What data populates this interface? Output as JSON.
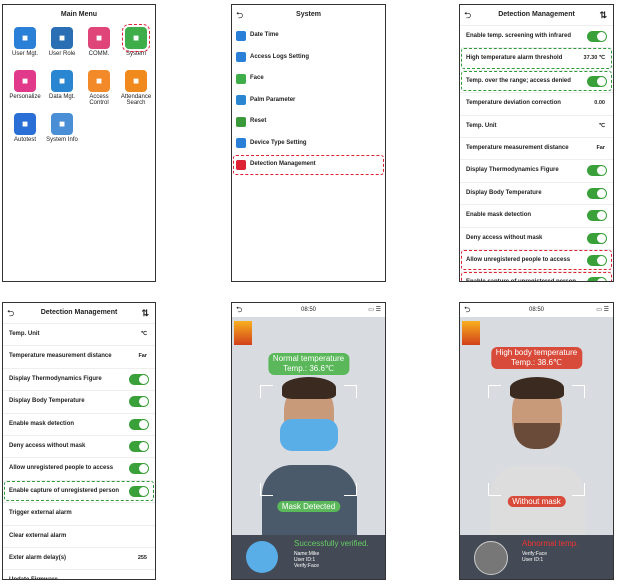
{
  "main_menu": {
    "title": "Main Menu",
    "items": [
      {
        "label": "User Mgt.",
        "color": "#2a7fd6"
      },
      {
        "label": "User Role",
        "color": "#2a6fb3"
      },
      {
        "label": "COMM.",
        "color": "#e0457a"
      },
      {
        "label": "System",
        "color": "#3fae4a"
      },
      {
        "label": "Personalize",
        "color": "#e23a8a"
      },
      {
        "label": "Data Mgt.",
        "color": "#2a86d0"
      },
      {
        "label": "Access Control",
        "color": "#f28a2a"
      },
      {
        "label": "Attendance Search",
        "color": "#f08a1d"
      },
      {
        "label": "Autotest",
        "color": "#2a6fd6"
      },
      {
        "label": "System Info",
        "color": "#4a8fd6"
      }
    ]
  },
  "system": {
    "title": "System",
    "items": [
      {
        "label": "Date Time",
        "color": "#2a7fd6"
      },
      {
        "label": "Access Logs Setting",
        "color": "#2a7fd6"
      },
      {
        "label": "Face",
        "color": "#3fae4a"
      },
      {
        "label": "Palm Parameter",
        "color": "#2a86d0"
      },
      {
        "label": "Reset",
        "color": "#3a9a3a"
      },
      {
        "label": "Device Type Setting",
        "color": "#2a7fd6"
      },
      {
        "label": "Detection Management",
        "color": "#d23"
      }
    ]
  },
  "detection1": {
    "title": "Detection Management",
    "rows": [
      {
        "label": "Enable temp. screening with infrared",
        "toggle": true
      },
      {
        "label": "High temperature alarm threshold",
        "value": "37.30 ℃"
      },
      {
        "label": "Temp. over the range; access denied",
        "toggle": true
      },
      {
        "label": "Temperature deviation correction",
        "value": "0.00"
      },
      {
        "label": "Temp. Unit",
        "value": "℃"
      },
      {
        "label": "Temperature measurement distance",
        "value": "Far"
      },
      {
        "label": "Display Thermodynamics Figure",
        "toggle": true
      },
      {
        "label": "Display Body Temperature",
        "toggle": true
      },
      {
        "label": "Enable mask detection",
        "toggle": true
      },
      {
        "label": "Deny access without mask",
        "toggle": true
      },
      {
        "label": "Allow unregistered people to access",
        "toggle": true
      },
      {
        "label": "Enable capture of unregistered person",
        "toggle": true
      }
    ]
  },
  "detection2": {
    "title": "Detection Management",
    "rows": [
      {
        "label": "Temp. Unit",
        "value": "℃"
      },
      {
        "label": "Temperature measurement distance",
        "value": "Far"
      },
      {
        "label": "Display Thermodynamics Figure",
        "toggle": true
      },
      {
        "label": "Display Body Temperature",
        "toggle": true
      },
      {
        "label": "Enable mask detection",
        "toggle": true
      },
      {
        "label": "Deny access without mask",
        "toggle": true
      },
      {
        "label": "Allow unregistered people to access",
        "toggle": true
      },
      {
        "label": "Enable capture of unregistered person",
        "toggle": true
      },
      {
        "label": "Trigger external alarm"
      },
      {
        "label": "Clear external alarm"
      },
      {
        "label": "Exter alarm delay(s)",
        "value": "255"
      },
      {
        "label": "Update Firmware"
      }
    ]
  },
  "screen_normal": {
    "time": "08:50",
    "temp_title": "Normal temperature",
    "temp_value": "Temp.: 36.6℃",
    "mask_label": "Mask Detected",
    "status": "Successfully verified.",
    "name": "Name:Mike",
    "userid": "User ID:1",
    "verify": "Verify:Face"
  },
  "screen_high": {
    "time": "08:50",
    "temp_title": "High body temperature",
    "temp_value": "Temp.: 38.6℃",
    "mask_label": "Without mask",
    "status": "Abnormal temp.",
    "verify": "Verify:Face",
    "userid": "User ID:1"
  }
}
